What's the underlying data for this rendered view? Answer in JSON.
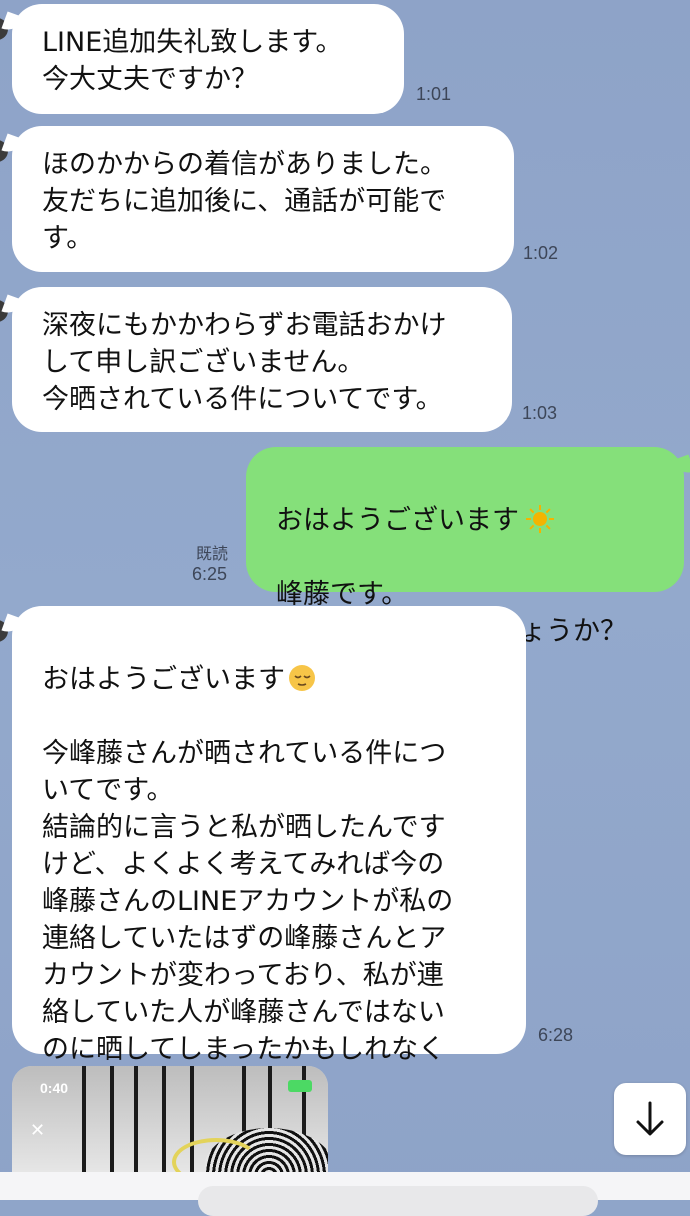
{
  "messages": [
    {
      "side": "in",
      "text": "LINE追加失礼致します。\n今大丈夫ですか？",
      "time": "1:01"
    },
    {
      "side": "in",
      "text": "ほのかからの着信がありました。\n友だちに追加後に、通話が可能で\nす。",
      "time": "1:02"
    },
    {
      "side": "in",
      "text": "深夜にもかかわらずお電話おかけ\nして申し訳ございません。\n今晒されている件についてです。",
      "time": "1:03"
    },
    {
      "side": "out",
      "line1": "おはようございます",
      "line2": "峰藤です。\nどうされましたでしょうか？",
      "read": "既読",
      "time": "6:25",
      "emoji": "sun-emoji"
    },
    {
      "side": "in",
      "line1": "おはようございます",
      "line2": "今峰藤さんが晒されている件につ\nいてです。\n結論的に言うと私が晒したんです\nけど、よくよく考えてみれば今の\n峰藤さんのLINEアカウントが私の\n連絡していたはずの峰藤さんとア\nカウントが変わっており、私が連\n絡していた人が峰藤さんではない\nのに晒してしまったかもしれなく\nて、",
      "time": "6:28",
      "emoji": "relieved-face-emoji"
    }
  ],
  "image_preview": {
    "status_time": "0:40"
  },
  "scroll_button": {
    "icon": "arrow-down-icon"
  },
  "colors": {
    "background": "#8fa5c9",
    "incoming": "#ffffff",
    "outgoing": "#85e07a"
  }
}
